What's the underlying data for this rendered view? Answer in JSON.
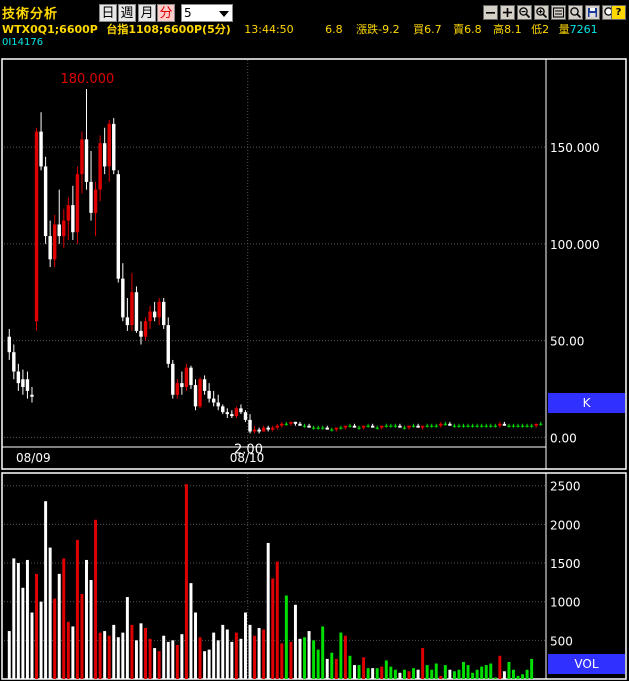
{
  "app": {
    "title": "技術分析"
  },
  "periods": [
    {
      "label": "日",
      "active": false
    },
    {
      "label": "週",
      "active": false
    },
    {
      "label": "月",
      "active": false
    },
    {
      "label": "分",
      "active": true
    }
  ],
  "interval": {
    "value": "5"
  },
  "toolbar": [
    "minus-icon",
    "plus-icon",
    "zoom-out-icon",
    "zoom-in-icon",
    "settings-icon",
    "zoom-icon",
    "save-icon",
    "search-icon",
    "help-icon"
  ],
  "toolbar_help_label": "?",
  "info": {
    "symbol": "WTX0Q1;6600P",
    "index": "台指1108;6600P(5分)",
    "time": "13:44:50",
    "last": "6.8",
    "change": "漲跌-9.2",
    "bid": "買6.7",
    "ask": "賣6.8",
    "high": "高8.1",
    "low": "低2",
    "volume_label": "量",
    "volume_value": "7261"
  },
  "code": "0I14176",
  "colors": {
    "up": "#e00000",
    "down": "#ffffff",
    "flat": "#00e000",
    "label_blue": "#3030ff",
    "grid": "#555555"
  },
  "chart_data": [
    {
      "type": "candlestick",
      "panel": "K",
      "ylim": [
        -5,
        195
      ],
      "yticks": [
        0,
        50,
        100,
        150
      ],
      "ytick_labels": [
        "0.00",
        "50.00",
        "100.000",
        "150.000"
      ],
      "x_labels": [
        "08/09",
        "08/10"
      ],
      "annotations": {
        "max": "180.000",
        "min": "2.00"
      },
      "label": "K",
      "ohlc": [
        [
          52,
          56,
          40,
          44
        ],
        [
          44,
          48,
          30,
          34
        ],
        [
          34,
          38,
          24,
          28
        ],
        [
          30,
          35,
          22,
          26
        ],
        [
          30,
          34,
          20,
          24
        ],
        [
          22,
          26,
          18,
          21
        ],
        [
          60,
          160,
          55,
          158
        ],
        [
          158,
          168,
          138,
          140
        ],
        [
          140,
          145,
          100,
          104
        ],
        [
          104,
          112,
          88,
          92
        ],
        [
          92,
          115,
          88,
          110
        ],
        [
          110,
          128,
          100,
          104
        ],
        [
          104,
          118,
          98,
          112
        ],
        [
          112,
          124,
          102,
          120
        ],
        [
          120,
          130,
          102,
          106
        ],
        [
          106,
          140,
          100,
          136
        ],
        [
          136,
          158,
          126,
          154
        ],
        [
          154,
          180,
          128,
          132
        ],
        [
          132,
          148,
          112,
          116
        ],
        [
          116,
          132,
          104,
          128
        ],
        [
          128,
          156,
          122,
          152
        ],
        [
          152,
          160,
          136,
          140
        ],
        [
          140,
          164,
          132,
          162
        ],
        [
          162,
          165,
          136,
          138
        ],
        [
          136,
          138,
          80,
          82
        ],
        [
          82,
          90,
          60,
          62
        ],
        [
          62,
          72,
          55,
          58
        ],
        [
          58,
          85,
          55,
          75
        ],
        [
          75,
          78,
          54,
          55
        ],
        [
          55,
          60,
          48,
          52
        ],
        [
          52,
          62,
          50,
          60
        ],
        [
          60,
          68,
          56,
          65
        ],
        [
          65,
          70,
          60,
          62
        ],
        [
          62,
          72,
          58,
          70
        ],
        [
          70,
          72,
          56,
          58
        ],
        [
          58,
          62,
          36,
          38
        ],
        [
          38,
          40,
          20,
          22
        ],
        [
          22,
          30,
          20,
          28
        ],
        [
          28,
          34,
          22,
          26
        ],
        [
          26,
          38,
          24,
          36
        ],
        [
          36,
          37,
          25,
          27
        ],
        [
          27,
          30,
          14,
          16
        ],
        [
          16,
          31,
          15,
          30
        ],
        [
          30,
          32,
          22,
          24
        ],
        [
          24,
          28,
          18,
          20
        ],
        [
          20,
          24,
          16,
          18
        ],
        [
          18,
          22,
          14,
          16
        ],
        [
          16,
          17,
          12,
          13
        ],
        [
          13,
          15,
          10,
          12
        ],
        [
          12,
          14,
          10,
          11
        ],
        [
          11,
          16,
          10,
          15
        ],
        [
          15,
          17,
          12,
          13
        ],
        [
          13,
          14,
          8,
          9
        ],
        [
          9,
          12,
          2,
          3
        ],
        [
          3,
          6,
          2,
          4
        ],
        [
          4,
          5,
          2,
          3
        ],
        [
          3,
          6,
          3,
          5
        ],
        [
          5,
          6,
          3,
          4
        ],
        [
          4,
          6,
          3,
          5
        ],
        [
          5,
          7,
          4,
          6
        ],
        [
          6,
          8,
          5,
          7
        ],
        [
          7,
          8,
          6,
          7
        ],
        [
          7,
          8,
          6,
          8
        ],
        [
          8,
          8,
          6,
          7
        ],
        [
          7,
          8,
          6,
          6
        ],
        [
          6,
          7,
          5,
          6
        ],
        [
          6,
          7,
          5,
          5
        ],
        [
          5,
          6,
          4,
          5
        ],
        [
          5,
          6,
          4,
          5
        ],
        [
          5,
          6,
          4,
          5
        ],
        [
          5,
          6,
          4,
          4
        ],
        [
          4,
          5,
          3,
          4
        ],
        [
          4,
          5,
          3,
          5
        ],
        [
          5,
          6,
          4,
          5
        ],
        [
          5,
          6,
          4,
          6
        ],
        [
          6,
          7,
          5,
          6
        ],
        [
          6,
          7,
          5,
          5
        ],
        [
          5,
          6,
          4,
          5
        ],
        [
          5,
          6,
          4,
          6
        ],
        [
          6,
          7,
          5,
          6
        ],
        [
          6,
          7,
          5,
          5
        ],
        [
          5,
          6,
          4,
          5
        ],
        [
          5,
          6,
          4,
          6
        ],
        [
          6,
          7,
          5,
          6
        ],
        [
          6,
          7,
          5,
          6
        ],
        [
          6,
          7,
          5,
          6
        ],
        [
          6,
          7,
          5,
          5
        ],
        [
          5,
          6,
          4,
          5
        ],
        [
          5,
          6,
          4,
          6
        ],
        [
          6,
          7,
          5,
          6
        ],
        [
          6,
          7,
          5,
          5
        ],
        [
          5,
          6,
          4,
          6
        ],
        [
          6,
          7,
          5,
          6
        ],
        [
          6,
          7,
          5,
          6
        ],
        [
          6,
          7,
          5,
          6
        ],
        [
          6,
          8,
          5,
          7
        ],
        [
          7,
          8,
          6,
          7
        ],
        [
          7,
          8,
          6,
          6
        ],
        [
          6,
          7,
          5,
          6
        ],
        [
          6,
          7,
          5,
          6
        ],
        [
          6,
          7,
          5,
          6
        ],
        [
          6,
          7,
          5,
          6
        ],
        [
          6,
          7,
          5,
          6
        ],
        [
          6,
          7,
          5,
          6
        ],
        [
          6,
          7,
          5,
          6
        ],
        [
          6,
          7,
          5,
          6
        ],
        [
          6,
          7,
          5,
          6
        ],
        [
          6,
          7,
          5,
          6
        ],
        [
          6,
          8,
          5,
          7
        ],
        [
          7,
          8,
          6,
          6
        ],
        [
          6,
          7,
          5,
          6
        ],
        [
          6,
          7,
          5,
          6
        ],
        [
          6,
          7,
          5,
          6
        ],
        [
          6,
          7,
          5,
          6
        ],
        [
          6,
          7,
          5,
          6
        ],
        [
          6,
          7,
          5,
          6
        ],
        [
          6,
          7,
          5,
          7
        ],
        [
          7,
          8,
          6,
          7
        ]
      ]
    },
    {
      "type": "bar",
      "panel": "VOL",
      "ylim": [
        0,
        2600
      ],
      "yticks": [
        500,
        1000,
        1500,
        2000,
        2500
      ],
      "ytick_labels": [
        "500",
        "1000",
        "1500",
        "2000",
        "2500"
      ],
      "label": "VOL",
      "values": [
        620,
        1560,
        1500,
        1180,
        1540,
        860,
        1360,
        1000,
        2300,
        1700,
        1040,
        1360,
        1560,
        740,
        680,
        1800,
        1100,
        1540,
        1280,
        2060,
        600,
        620,
        560,
        700,
        540,
        600,
        1060,
        700,
        500,
        720,
        660,
        520,
        400,
        360,
        560,
        480,
        500,
        440,
        580,
        2520,
        1240,
        860,
        540,
        360,
        380,
        600,
        500,
        700,
        640,
        480,
        600,
        520,
        860,
        700,
        560,
        660,
        640,
        1760,
        1300,
        1520,
        460,
        1080,
        480,
        960,
        520,
        540,
        620,
        500,
        380,
        680,
        260,
        340,
        260,
        600,
        560,
        300,
        180,
        180,
        280,
        140,
        140,
        140,
        160,
        240,
        160,
        120,
        80,
        120,
        100,
        140,
        120,
        400,
        180,
        120,
        200,
        40,
        180,
        120,
        100,
        120,
        220,
        180,
        80,
        120,
        160,
        180,
        200,
        20,
        300,
        100,
        220,
        120,
        40,
        60,
        120,
        260
      ]
    }
  ]
}
